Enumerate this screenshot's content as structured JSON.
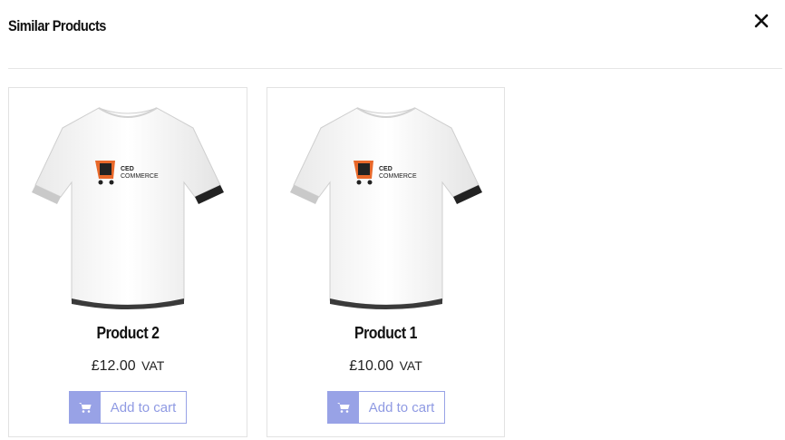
{
  "modal": {
    "title": "Similar Products",
    "close_icon": "close-icon"
  },
  "products": [
    {
      "name": "Product 2",
      "price": "£12.00",
      "tax_label": "VAT",
      "button_label": "Add to cart",
      "image_logo": "CED COMMERCE",
      "cart_icon": "cart-icon"
    },
    {
      "name": "Product 1",
      "price": "£10.00",
      "tax_label": "VAT",
      "button_label": "Add to cart",
      "image_logo": "CED COMMERCE",
      "cart_icon": "cart-icon"
    }
  ],
  "colors": {
    "accent": "#98a2e6",
    "border": "#e2e2e2",
    "logo_orange": "#e8682a"
  }
}
